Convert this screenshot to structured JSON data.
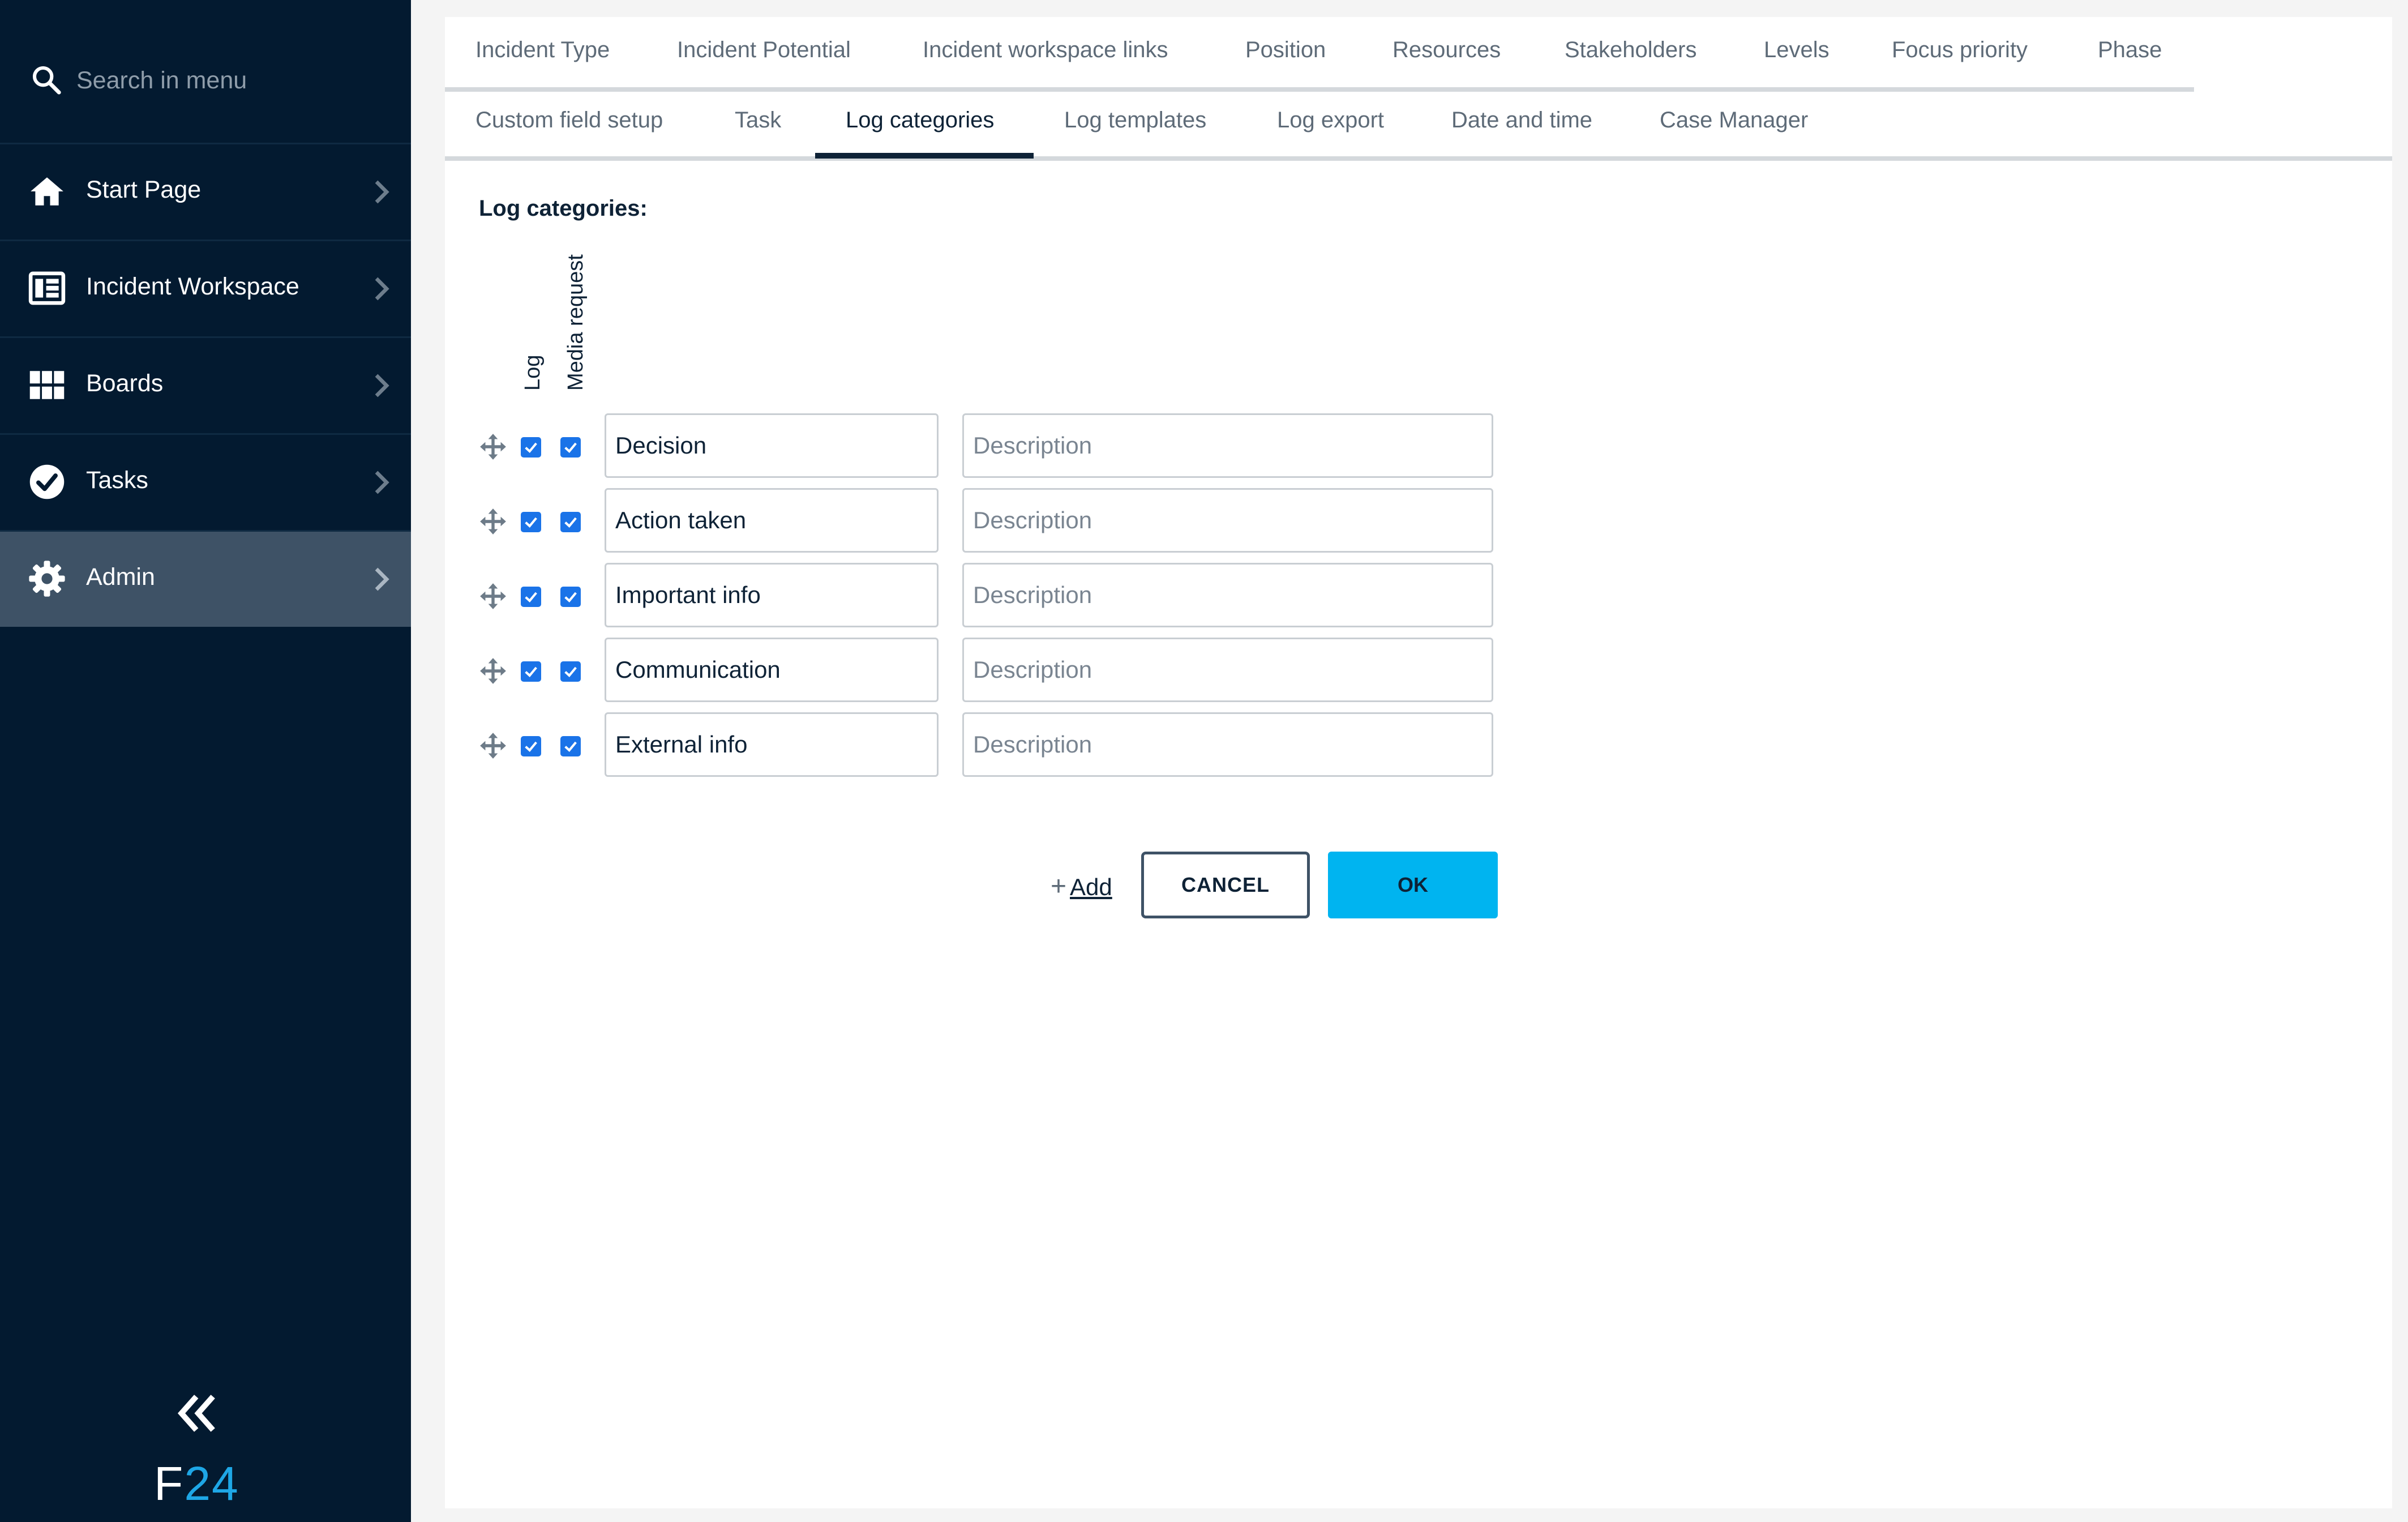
{
  "sidebar": {
    "search_placeholder": "Search in menu",
    "items": [
      {
        "label": "Start Page",
        "icon": "home-icon"
      },
      {
        "label": "Incident Workspace",
        "icon": "workspace-icon"
      },
      {
        "label": "Boards",
        "icon": "grid-icon"
      },
      {
        "label": "Tasks",
        "icon": "check-circle-icon"
      },
      {
        "label": "Admin",
        "icon": "gear-icon",
        "active": true
      }
    ],
    "logo_f": "F",
    "logo_num": "24"
  },
  "tabs_row1": [
    "Incident Type",
    "Incident Potential",
    "Incident workspace links",
    "Position",
    "Resources",
    "Stakeholders",
    "Levels",
    "Focus priority",
    "Phase"
  ],
  "tabs_row2": [
    "Custom field setup",
    "Task",
    "Log categories",
    "Log templates",
    "Log export",
    "Date and time",
    "Case Manager"
  ],
  "active_tab": "Log categories",
  "content": {
    "title": "Log categories:",
    "col_log": "Log",
    "col_media": "Media request",
    "description_placeholder": "Description",
    "rows": [
      {
        "name": "Decision",
        "log": true,
        "media": true
      },
      {
        "name": "Action taken",
        "log": true,
        "media": true
      },
      {
        "name": "Important info",
        "log": true,
        "media": true
      },
      {
        "name": "Communication",
        "log": true,
        "media": true
      },
      {
        "name": "External info",
        "log": true,
        "media": true
      }
    ],
    "add_plus": "+",
    "add_label": "Add",
    "cancel_label": "CANCEL",
    "ok_label": "OK"
  },
  "colors": {
    "sidebar_bg": "#031a30",
    "active_nav_bg": "#3e5266",
    "accent": "#00b4f0",
    "checkbox": "#1a73e8"
  }
}
